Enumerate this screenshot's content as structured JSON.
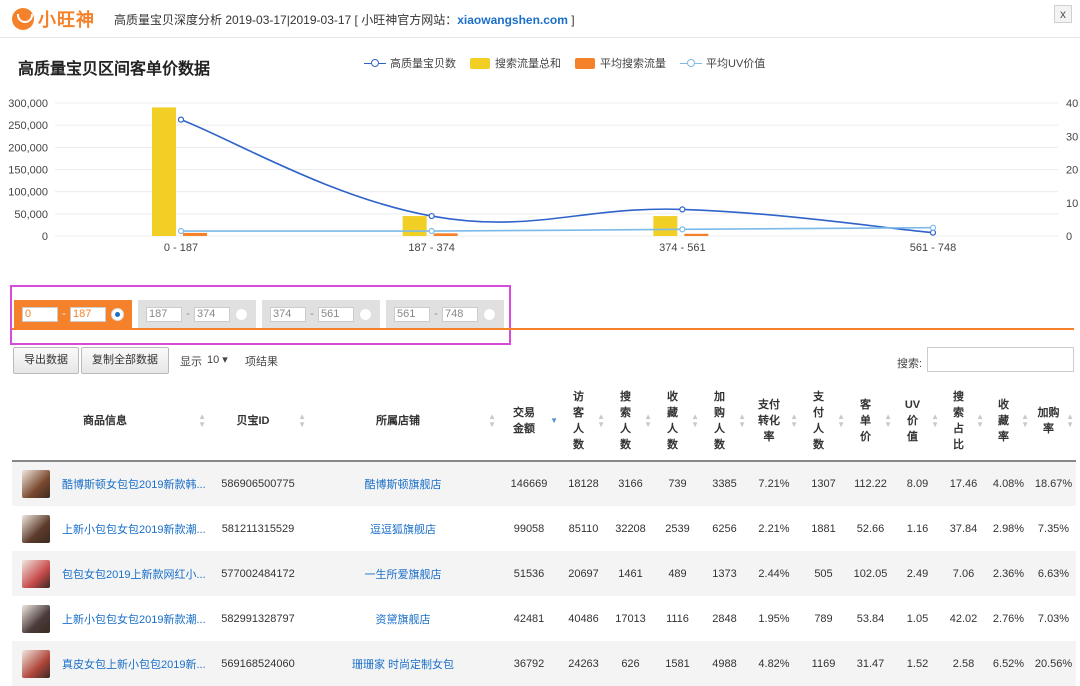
{
  "header": {
    "brand": "小旺神",
    "title_prefix": "高质量宝贝深度分析 2019-03-17|2019-03-17 [ 小旺神官方网站：",
    "site": "xiaowangshen.com",
    "title_suffix": " ]",
    "close_label": "x"
  },
  "chart_title": "高质量宝贝区间客单价数据",
  "legend": [
    {
      "label": "高质量宝贝数",
      "color": "#2f63c9",
      "kind": "line"
    },
    {
      "label": "搜索流量总和",
      "color": "#f2cf25",
      "kind": "bar"
    },
    {
      "label": "平均搜索流量",
      "color": "#f5822a",
      "kind": "bar"
    },
    {
      "label": "平均UV价值",
      "color": "#7cbbe9",
      "kind": "line"
    }
  ],
  "chart_data": {
    "type": "bar",
    "categories": [
      "0 - 187",
      "187 - 374",
      "374 - 561",
      "561 - 748"
    ],
    "left_axis": {
      "ticks": [
        "0",
        "50,000",
        "100,000",
        "150,000",
        "200,000",
        "250,000",
        "300,000"
      ],
      "ylim": [
        0,
        300000
      ]
    },
    "right_axis": {
      "ticks": [
        "0",
        "10",
        "20",
        "30",
        "40"
      ],
      "ylim": [
        0,
        40
      ]
    },
    "series": [
      {
        "name": "搜索流量总和",
        "kind": "bar",
        "axis": "left",
        "color": "#f2cf25",
        "values": [
          290000,
          45000,
          45000,
          0
        ]
      },
      {
        "name": "平均搜索流量",
        "kind": "bar",
        "axis": "left",
        "color": "#f5822a",
        "values": [
          7000,
          6000,
          5000,
          0
        ]
      },
      {
        "name": "高质量宝贝数",
        "kind": "line",
        "axis": "right",
        "color": "#2f63c9",
        "values": [
          35,
          6,
          8,
          1
        ]
      },
      {
        "name": "平均UV价值",
        "kind": "line",
        "axis": "right",
        "color": "#7cbbe9",
        "values": [
          1.5,
          1.5,
          2,
          2.5
        ]
      }
    ]
  },
  "ranges": [
    {
      "from": "0",
      "to": "187",
      "active": true
    },
    {
      "from": "187",
      "to": "374",
      "active": false
    },
    {
      "from": "374",
      "to": "561",
      "active": false
    },
    {
      "from": "561",
      "to": "748",
      "active": false
    }
  ],
  "controls": {
    "export_label": "导出数据",
    "copy_label": "复制全部数据",
    "show_label": "显示",
    "show_value": "10  ▾",
    "show_suffix": "项结果",
    "search_label": "搜索:"
  },
  "columns": [
    "商品信息",
    "贝宝ID",
    "所属店铺",
    "交易\n金额",
    "访\n客\n人\n数",
    "搜\n索\n人\n数",
    "收\n藏\n人\n数",
    "加\n购\n人\n数",
    "支付\n转化\n率",
    "支\n付\n人\n数",
    "客\n单\n价",
    "UV\n价\n值",
    "搜\n索\n占\n比",
    "收\n藏\n率",
    "加购\n率"
  ],
  "rows": [
    {
      "thumb": "#7a4a2e",
      "name": "酷博斯顿女包包2019新款韩...",
      "id": "586906500775",
      "shop": "酷博斯顿旗舰店",
      "cells": [
        "146669",
        "18128",
        "3166",
        "739",
        "3385",
        "7.21%",
        "1307",
        "112.22",
        "8.09",
        "17.46",
        "4.08%",
        "18.67%"
      ]
    },
    {
      "thumb": "#5c3a2a",
      "name": "上新小包包女包2019新款潮...",
      "id": "581211315529",
      "shop": "逗逗狐旗舰店",
      "cells": [
        "99058",
        "85110",
        "32208",
        "2539",
        "6256",
        "2.21%",
        "1881",
        "52.66",
        "1.16",
        "37.84",
        "2.98%",
        "7.35%"
      ]
    },
    {
      "thumb": "#c74b4b",
      "name": "包包女包2019上新款网红小...",
      "id": "577002484172",
      "shop": "一生所爱旗舰店",
      "cells": [
        "51536",
        "20697",
        "1461",
        "489",
        "1373",
        "2.44%",
        "505",
        "102.05",
        "2.49",
        "7.06",
        "2.36%",
        "6.63%"
      ]
    },
    {
      "thumb": "#4a3a3a",
      "name": "上新小包包女包2019新款潮...",
      "id": "582991328797",
      "shop": "资黛旗舰店",
      "cells": [
        "42481",
        "40486",
        "17013",
        "1116",
        "2848",
        "1.95%",
        "789",
        "53.84",
        "1.05",
        "42.02",
        "2.76%",
        "7.03%"
      ]
    },
    {
      "thumb": "#b0463a",
      "name": "真皮女包上新小包包2019新...",
      "id": "569168524060",
      "shop": "珊珊家 时尚定制女包",
      "cells": [
        "36792",
        "24263",
        "626",
        "1581",
        "4988",
        "4.82%",
        "1169",
        "31.47",
        "1.52",
        "2.58",
        "6.52%",
        "20.56%"
      ]
    }
  ]
}
